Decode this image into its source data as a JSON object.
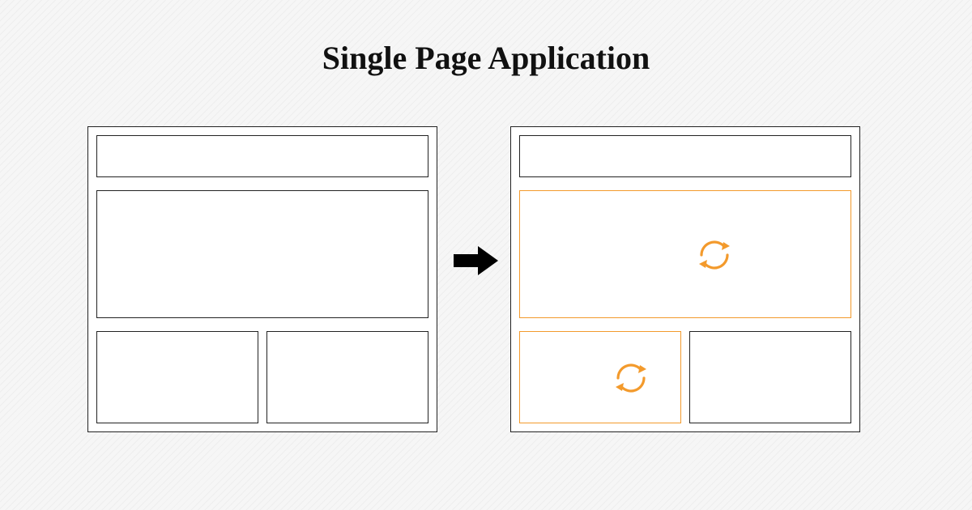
{
  "title": "Single Page Application",
  "colors": {
    "accent": "#f39a2c",
    "stroke": "#222222",
    "arrow": "#000000",
    "bg": "#f5f5f5"
  },
  "diagram": {
    "left": {
      "frame": true,
      "sections": [
        "header",
        "hero",
        "bottom-left",
        "bottom-right"
      ],
      "highlighted": []
    },
    "right": {
      "frame": true,
      "sections": [
        "header",
        "hero",
        "bottom-left",
        "bottom-right"
      ],
      "highlighted": [
        "hero",
        "bottom-left"
      ],
      "refresh_icons_in": [
        "hero",
        "bottom-left"
      ]
    },
    "arrow_direction": "right"
  }
}
